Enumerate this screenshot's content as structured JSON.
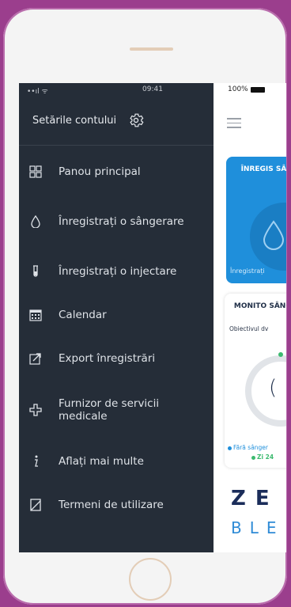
{
  "status_bar": {
    "signal": "••ıl ᯤ",
    "time": "09:41",
    "battery": "100%"
  },
  "sidebar": {
    "settings_label": "Setările contului",
    "items": [
      {
        "label": "Panou principal",
        "icon": "dashboard-icon"
      },
      {
        "label": "Înregistrați o sângerare",
        "icon": "blood-drop-icon"
      },
      {
        "label": "Înregistrați o injectare",
        "icon": "vial-icon"
      },
      {
        "label": "Calendar",
        "icon": "calendar-icon"
      },
      {
        "label": "Export înregistrări",
        "icon": "export-icon"
      },
      {
        "label": "Furnizor de servicii medicale",
        "icon": "medical-cross-icon"
      },
      {
        "label": "Aflați mai multe",
        "icon": "info-icon"
      },
      {
        "label": "Termeni de utilizare",
        "icon": "document-icon"
      }
    ]
  },
  "content": {
    "blue_card": {
      "title": "ÎNREGIS SÂNGE",
      "footer": "Înregistrați"
    },
    "monitor_card": {
      "title": "MONITO SÂNGI",
      "subtitle": "Obiectivul dv",
      "ring_value": "(",
      "legend_no_bleed": "Fără sânger",
      "legend_days": "Zi 24"
    },
    "logo": {
      "line1": "ZE",
      "line2": "BLE"
    }
  },
  "colors": {
    "background": "#9b3e8d",
    "sidebar": "#252d38",
    "accent_blue": "#1f8fdb",
    "accent_green": "#3cba6f"
  }
}
